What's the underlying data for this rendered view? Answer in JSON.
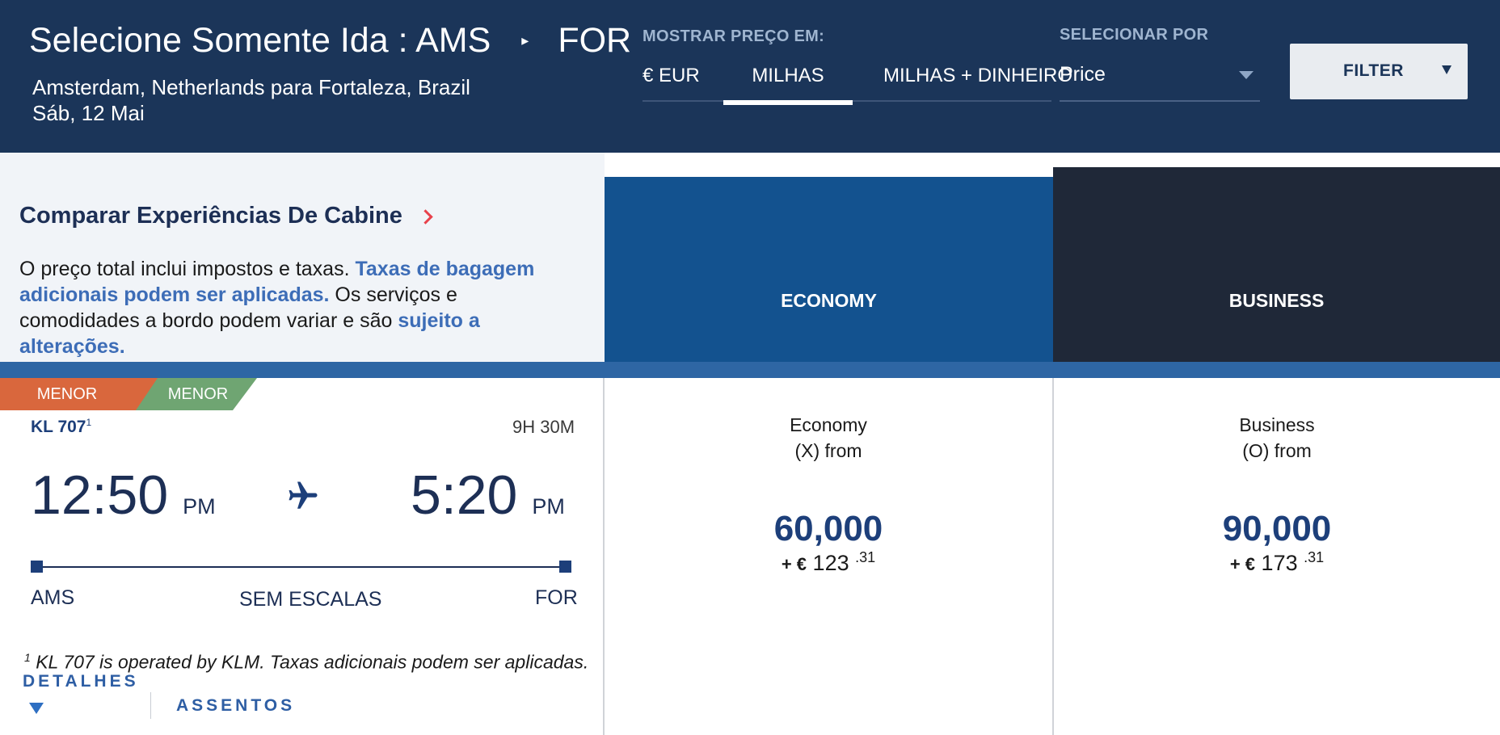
{
  "header": {
    "title_prefix": "Selecione Somente Ida : AMS",
    "title_dest": "FOR",
    "route": "Amsterdam, Netherlands para Fortaleza, Brazil",
    "date": "Sáb, 12 Mai",
    "show_price_label": "MOSTRAR PREÇO EM:",
    "price_tabs": [
      "€ EUR",
      "MILHAS",
      "MILHAS + DINHEIRO"
    ],
    "active_price_tab": "MILHAS",
    "sort_label": "SELECIONAR POR",
    "sort_value": "Price",
    "filter_label": "FILTER"
  },
  "info": {
    "compare_link": "Comparar Experiências De Cabine",
    "text_1": "O preço total inclui impostos e taxas. ",
    "link_1": "Taxas de bagagem adicionais podem ser aplicadas.",
    "text_2": " Os serviços e comodidades a bordo podem variar e são ",
    "link_2": "sujeito a alterações."
  },
  "cabins": {
    "economy": "ECONOMY",
    "business": "BUSINESS"
  },
  "flight": {
    "badges": [
      "MENOR",
      "MENOR"
    ],
    "flight_number": "KL 707",
    "footnote_mark": "1",
    "duration": "9H 30M",
    "departure": {
      "time": "12:50",
      "ampm": "PM",
      "code": "AMS"
    },
    "arrival": {
      "time": "5:20",
      "ampm": "PM",
      "code": "FOR"
    },
    "stops": "SEM ESCALAS",
    "footnote": "KL 707 is operated by KLM. Taxas adicionais podem ser aplicadas.",
    "details_label": "DETALHES",
    "seats_label": "ASSENTOS"
  },
  "fares": {
    "economy": {
      "line1": "Economy",
      "line2": "(X) from",
      "miles": "60,000",
      "cash_prefix": "+ €",
      "cash_whole": "123",
      "cash_cents": ".31"
    },
    "business": {
      "line1": "Business",
      "line2": "(O) from",
      "miles": "90,000",
      "cash_prefix": "+ €",
      "cash_whole": "173",
      "cash_cents": ".31"
    }
  },
  "colors": {
    "header_bg": "#1b3559",
    "economy_bg": "#13528f",
    "business_bg": "#1f2838",
    "badge_orange": "#d9673d",
    "badge_green": "#6fa572",
    "link_blue": "#3d6db7"
  },
  "icons": [
    "play-triangle-icon",
    "chevron-right-icon",
    "caret-down-icon",
    "airplane-icon"
  ]
}
